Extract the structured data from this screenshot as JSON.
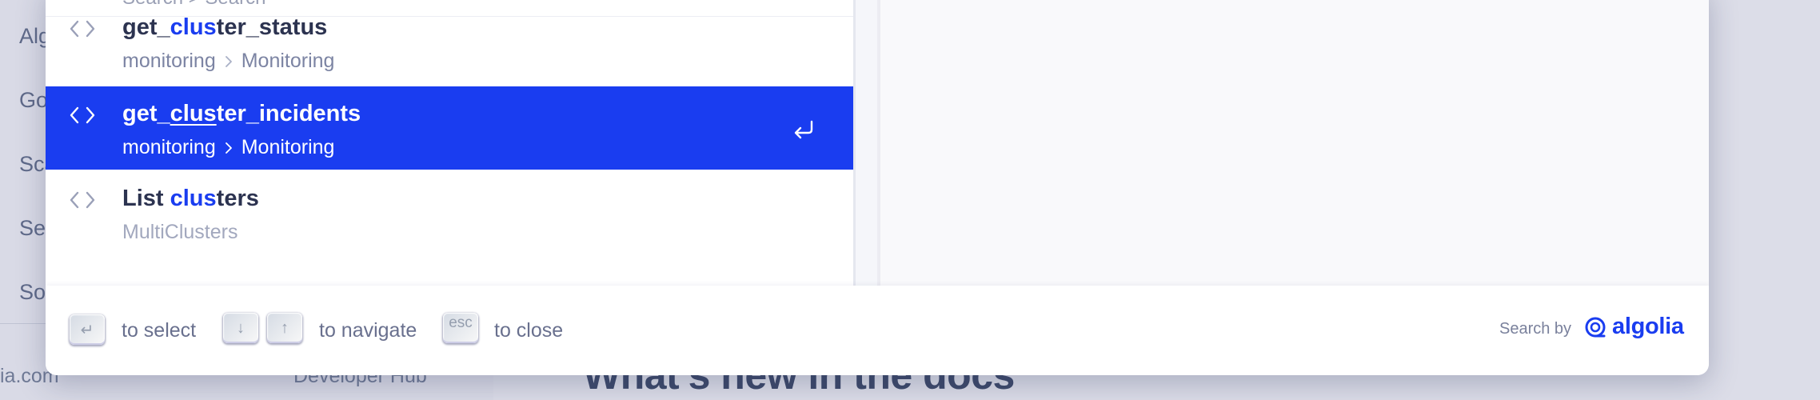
{
  "background": {
    "sidebar_items": [
      "Alg",
      "Go",
      "Sca",
      "Se",
      "So"
    ],
    "footer_left": "ia.com",
    "footer_hub": "Developer Hub",
    "main_heading": "What's new in the docs"
  },
  "results": {
    "partial_row_text": "Search  >  Search",
    "hits": [
      {
        "title_prefix": "get_",
        "title_highlight": "clus",
        "title_suffix": "ter_status",
        "path_level1": "monitoring",
        "path_level2": "Monitoring",
        "icon": "code-icon",
        "selected": false
      },
      {
        "title_prefix": "get_",
        "title_highlight": "clus",
        "title_suffix": "ter_incidents",
        "path_level1": "monitoring",
        "path_level2": "Monitoring",
        "icon": "code-icon",
        "selected": true,
        "action_icon": "enter-icon"
      },
      {
        "title_prefix": "List ",
        "title_highlight": "clus",
        "title_suffix": "ters",
        "path_level1": "MultiClusters",
        "icon": "code-icon",
        "selected": false
      }
    ]
  },
  "footer": {
    "select_key": "↵",
    "select_label": "to select",
    "down_key": "↓",
    "up_key": "↑",
    "navigate_label": "to navigate",
    "esc_key": "esc",
    "close_label": "to close",
    "search_by": "Search by",
    "brand": "algolia"
  },
  "colors": {
    "accent": "#1a3df0",
    "title_text": "#2c3350",
    "muted_text": "#7c84a3",
    "overlay_background": "#d7d8e3"
  }
}
